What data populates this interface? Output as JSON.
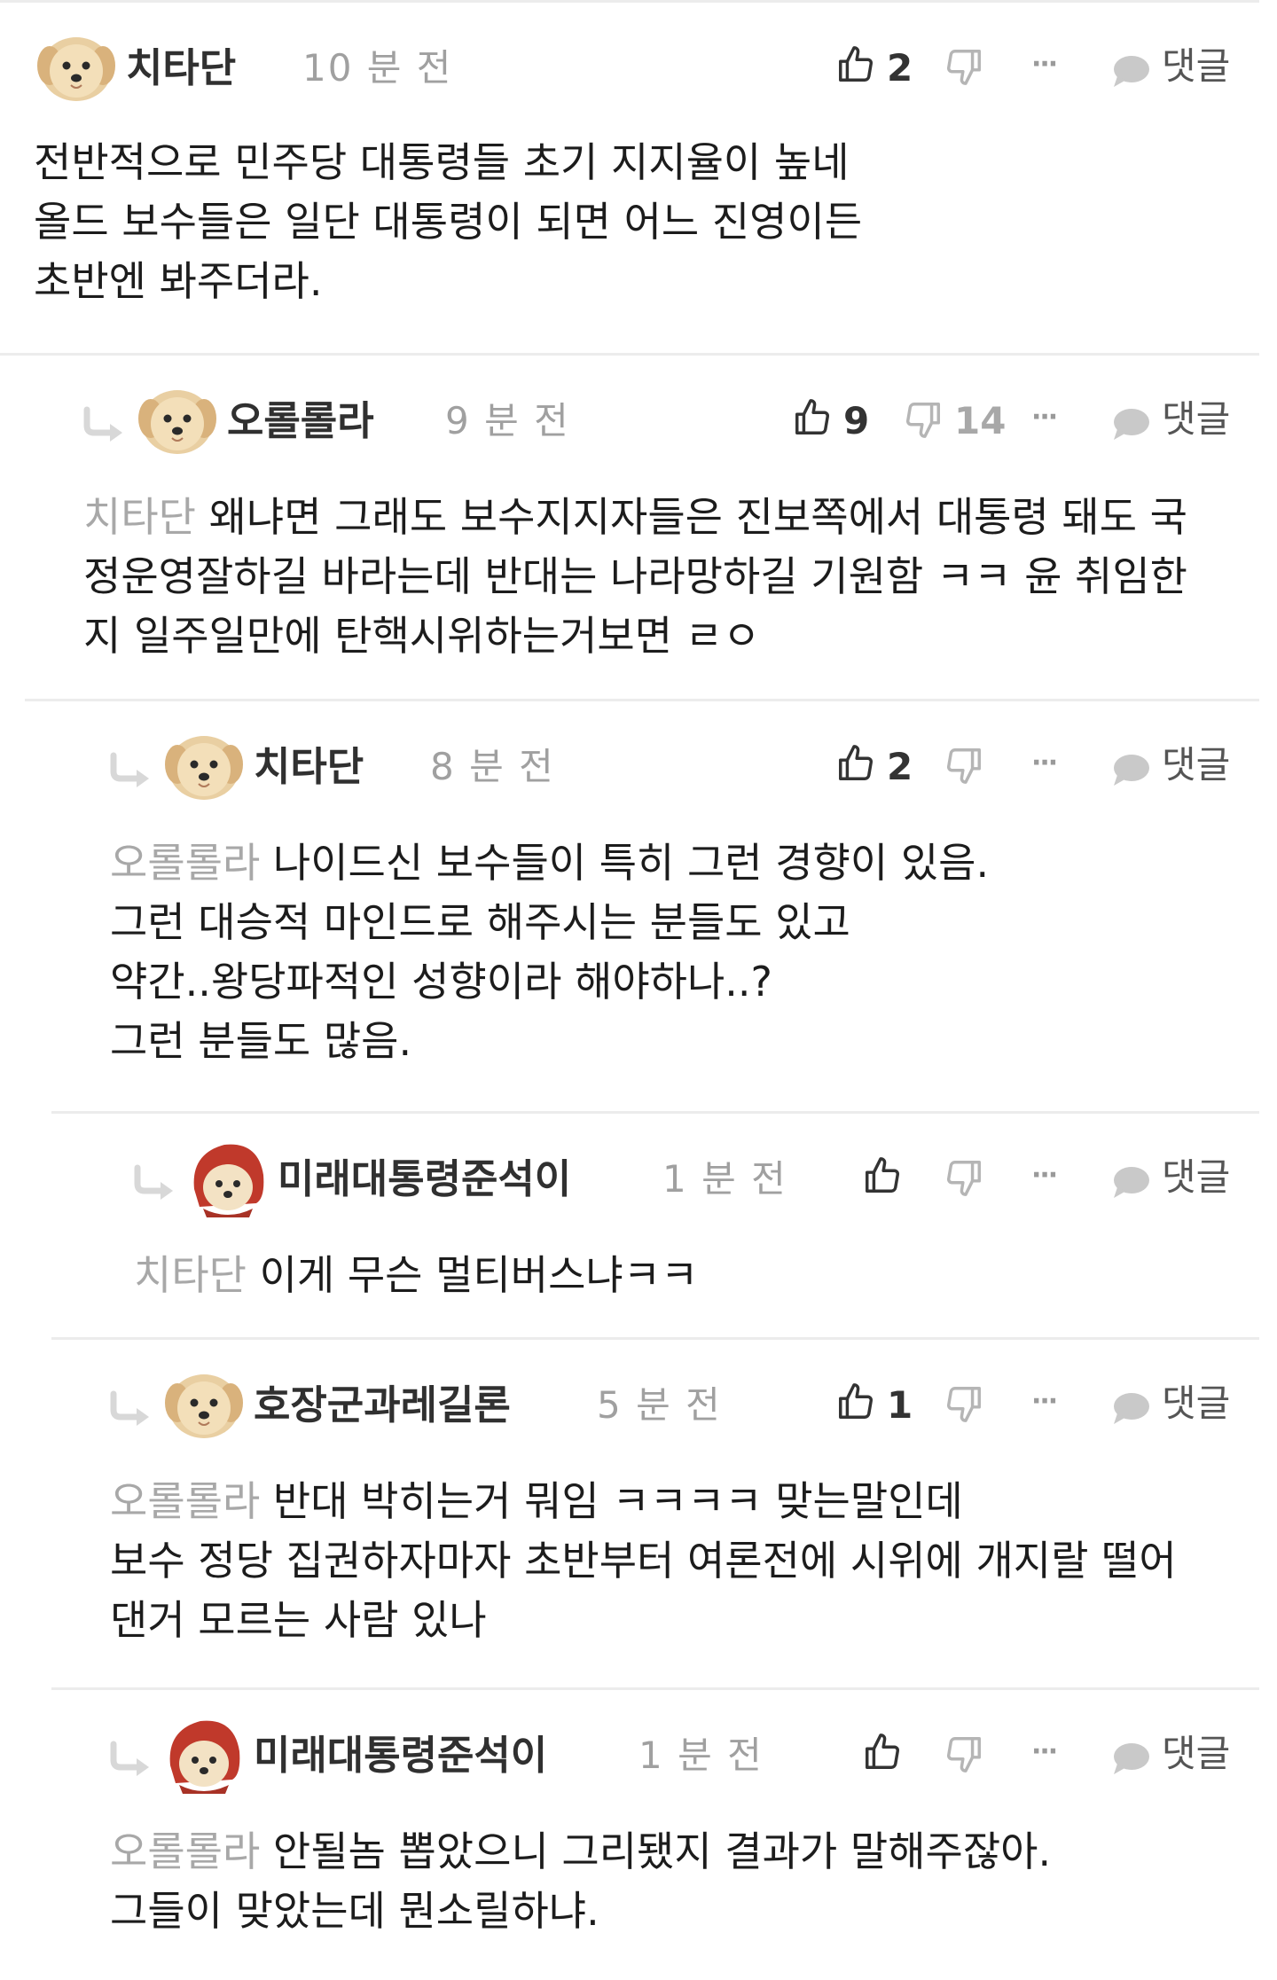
{
  "labels": {
    "reply": "댓글",
    "more": "···"
  },
  "comments": [
    {
      "author": "치타단",
      "time": "10 분 전",
      "avatar": "puppy-avatar",
      "likes": "2",
      "dislikes": "",
      "mention": "",
      "lines": [
        "전반적으로 민주당 대통령들 초기 지지율이 높네",
        "올드 보수들은 일단 대통령이 되면 어느 진영이든",
        "초반엔 봐주더라."
      ]
    },
    {
      "author": "오롤롤라",
      "time": "9 분 전",
      "avatar": "puppy-avatar",
      "likes": "9",
      "dislikes": "14",
      "mention": "치타단",
      "lines": [
        " 왜냐면 그래도 보수지지자들은 진보쪽에서 대통령 돼도 국",
        "정운영잘하길 바라는데 반대는 나라망하길 기원함 ㅋㅋ 윤 취임한",
        "지 일주일만에 탄핵시위하는거보면 ㄹㅇ"
      ]
    },
    {
      "author": "치타단",
      "time": "8 분 전",
      "avatar": "puppy-avatar",
      "likes": "2",
      "dislikes": "",
      "mention": "오롤롤라",
      "lines": [
        " 나이드신 보수들이 특히 그런 경향이 있음.",
        "그런 대승적 마인드로 해주시는 분들도 있고",
        "약간..왕당파적인 성향이라 해야하나..?",
        "그런 분들도 많음."
      ]
    },
    {
      "author": "미래대통령준석이",
      "time": "1 분 전",
      "avatar": "red-hood-puppy-avatar",
      "likes": "",
      "dislikes": "",
      "mention": "치타단",
      "lines": [
        " 이게 무슨 멀티버스냐ㅋㅋ"
      ]
    },
    {
      "author": "호장군과레길론",
      "time": "5 분 전",
      "avatar": "puppy-avatar",
      "likes": "1",
      "dislikes": "",
      "mention": "오롤롤라",
      "lines": [
        " 반대 박히는거 뭐임 ㅋㅋㅋㅋ 맞는말인데",
        "보수 정당 집권하자마자 초반부터 여론전에 시위에 개지랄 떨어",
        "댄거 모르는 사람 있나"
      ]
    },
    {
      "author": "미래대통령준석이",
      "time": "1 분 전",
      "avatar": "red-hood-puppy-avatar",
      "likes": "",
      "dislikes": "",
      "mention": "오롤롤라",
      "lines": [
        " 안될놈 뽑았으니 그리됐지 결과가 말해주잖아.",
        "그들이 맞았는데 뭔소릴하냐."
      ]
    }
  ]
}
